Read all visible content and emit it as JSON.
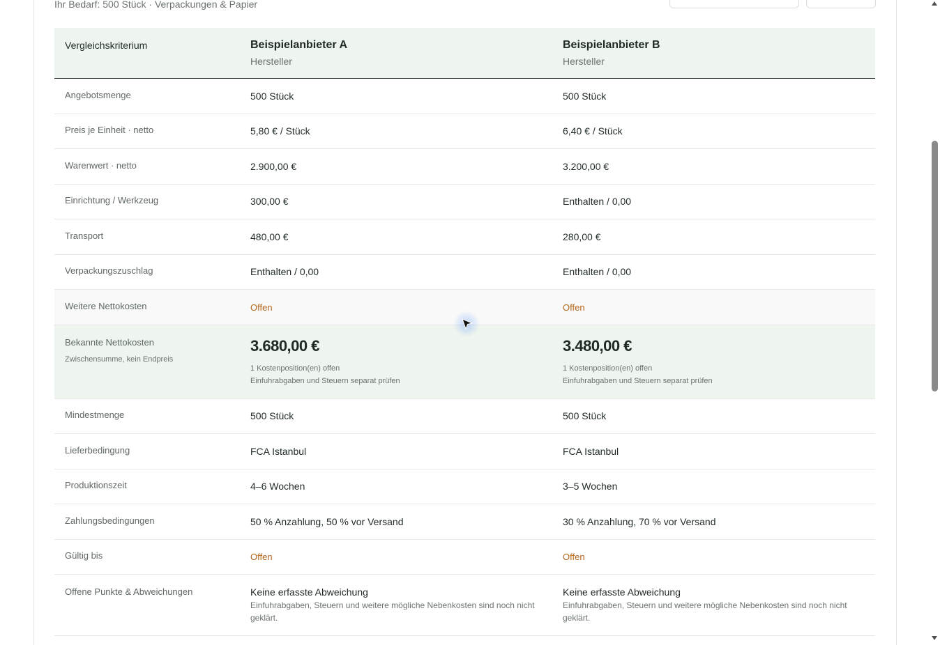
{
  "subtitle": "Ihr Bedarf: 500 Stück · Verpackungen & Papier",
  "header": {
    "criterion_label": "Vergleichskriterium",
    "vendor_a": {
      "name": "Beispielanbieter A",
      "type": "Hersteller"
    },
    "vendor_b": {
      "name": "Beispielanbieter B",
      "type": "Hersteller"
    }
  },
  "rows_top": [
    {
      "label": "Angebotsmenge",
      "a": "500 Stück",
      "b": "500 Stück"
    },
    {
      "label": "Preis je Einheit · netto",
      "a": "5,80 € / Stück",
      "b": "6,40 € / Stück"
    },
    {
      "label": "Warenwert · netto",
      "a": "2.900,00 €",
      "b": "3.200,00 €"
    },
    {
      "label": "Einrichtung / Werkzeug",
      "a": "300,00 €",
      "b": "Enthalten / 0,00"
    },
    {
      "label": "Transport",
      "a": "480,00 €",
      "b": "280,00 €"
    },
    {
      "label": "Verpackungszuschlag",
      "a": "Enthalten / 0,00",
      "b": "Enthalten / 0,00"
    },
    {
      "label": "Weitere Nettokosten",
      "a": "Offen",
      "b": "Offen"
    }
  ],
  "total": {
    "label": "Bekannte Nettokosten",
    "sublabel": "Zwischensumme, kein Endpreis",
    "a": {
      "value": "3.680,00 €",
      "note1": "1 Kostenposition(en) offen",
      "note2": "Einfuhrabgaben und Steuern separat prüfen"
    },
    "b": {
      "value": "3.480,00 €",
      "note1": "1 Kostenposition(en) offen",
      "note2": "Einfuhrabgaben und Steuern separat prüfen"
    }
  },
  "rows_bottom": [
    {
      "label": "Mindestmenge",
      "a": "500 Stück",
      "b": "500 Stück"
    },
    {
      "label": "Lieferbedingung",
      "a": "FCA Istanbul",
      "b": "FCA Istanbul"
    },
    {
      "label": "Produktionszeit",
      "a": "4–6 Wochen",
      "b": "3–5 Wochen"
    },
    {
      "label": "Zahlungsbedingungen",
      "a": "50 % Anzahlung, 50 % vor Versand",
      "b": "30 % Anzahlung, 70 % vor Versand"
    },
    {
      "label": "Gültig bis",
      "a": "Offen",
      "b": "Offen"
    }
  ],
  "deviations": {
    "label": "Offene Punkte & Abweichungen",
    "a": {
      "title": "Keine erfasste Abweichung",
      "note": "Einfuhrabgaben, Steuern und weitere mögliche Nebenkosten sind noch nicht geklärt."
    },
    "b": {
      "title": "Keine erfasste Abweichung",
      "note": "Einfuhrabgaben, Steuern und weitere mögliche Nebenkosten sind noch nicht geklärt."
    }
  },
  "colors": {
    "accent_bg": "#eef4ee",
    "open_text": "#b5651d",
    "text_dark": "#1f2a24"
  }
}
